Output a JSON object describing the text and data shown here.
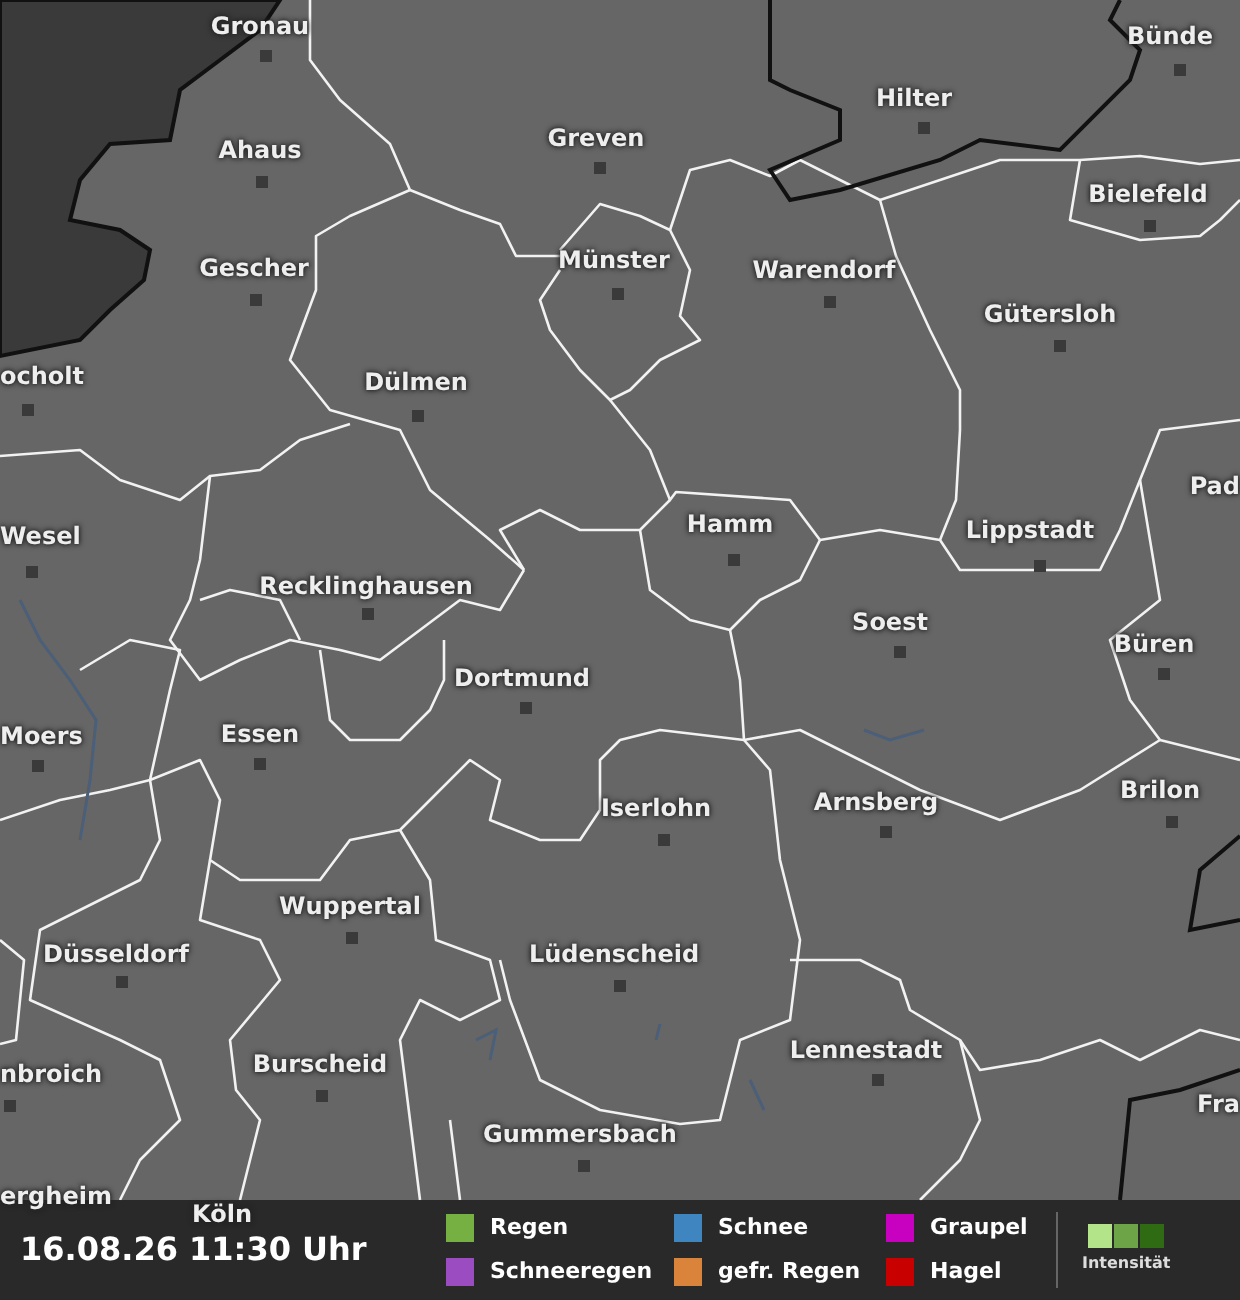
{
  "map": {
    "cities": [
      {
        "name": "Gronau"
      },
      {
        "name": "Ahaus"
      },
      {
        "name": "Greven"
      },
      {
        "name": "Hilter"
      },
      {
        "name": "Bünde"
      },
      {
        "name": "Bielefeld"
      },
      {
        "name": "Gescher"
      },
      {
        "name": "Münster"
      },
      {
        "name": "Warendorf"
      },
      {
        "name": "Gütersloh"
      },
      {
        "name": "ocholt"
      },
      {
        "name": "Dülmen"
      },
      {
        "name": "Pad"
      },
      {
        "name": "Wesel"
      },
      {
        "name": "Hamm"
      },
      {
        "name": "Lippstadt"
      },
      {
        "name": "Recklinghausen"
      },
      {
        "name": "Soest"
      },
      {
        "name": "Büren"
      },
      {
        "name": "Dortmund"
      },
      {
        "name": "Moers"
      },
      {
        "name": "Essen"
      },
      {
        "name": "Iserlohn"
      },
      {
        "name": "Arnsberg"
      },
      {
        "name": "Brilon"
      },
      {
        "name": "Wuppertal"
      },
      {
        "name": "Düsseldorf"
      },
      {
        "name": "Lüdenscheid"
      },
      {
        "name": "Lennestadt"
      },
      {
        "name": "nbroich"
      },
      {
        "name": "Burscheid"
      },
      {
        "name": "Gummersbach"
      },
      {
        "name": "Fra"
      },
      {
        "name": "ergheim"
      },
      {
        "name": "Köln"
      }
    ]
  },
  "footer": {
    "timestamp": "16.08.26 11:30 Uhr",
    "legend": [
      {
        "label": "Regen",
        "color": "#76b043"
      },
      {
        "label": "Schneeregen",
        "color": "#9a4cc0"
      },
      {
        "label": "Schnee",
        "color": "#3f86c0"
      },
      {
        "label": "gefr. Regen",
        "color": "#d9843a"
      },
      {
        "label": "Graupel",
        "color": "#c800c0"
      },
      {
        "label": "Hagel",
        "color": "#c80000"
      }
    ],
    "intensity": {
      "label": "Intensität",
      "levels": [
        {
          "color": "#b4e48a"
        },
        {
          "color": "#6ea448"
        },
        {
          "color": "#2f6b12"
        }
      ]
    }
  }
}
